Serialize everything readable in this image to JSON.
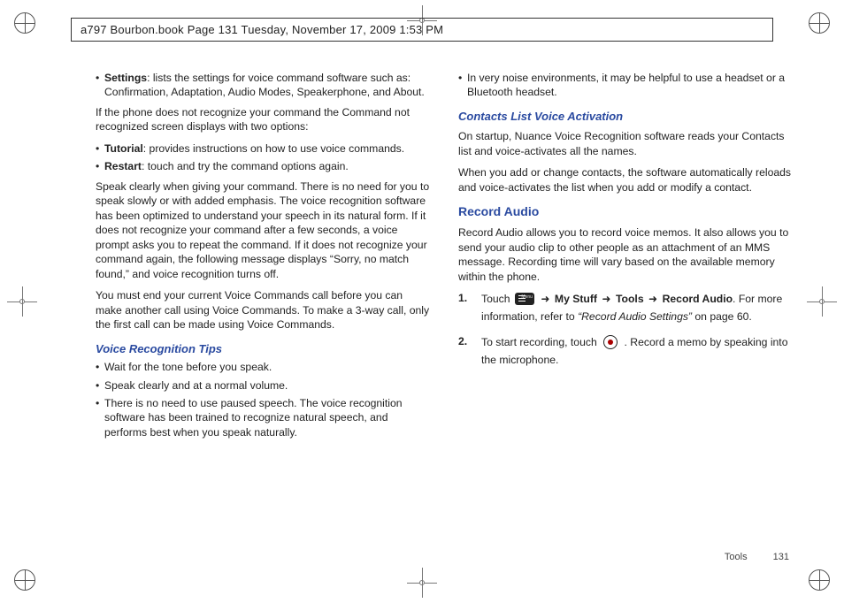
{
  "header": "a797 Bourbon.book  Page 131  Tuesday, November 17, 2009  1:53 PM",
  "left": {
    "settings_lead": "Settings",
    "settings_rest": ": lists the settings for voice command software such as: Confirmation, Adaptation, Audio Modes, Speakerphone, and About.",
    "unrecognized": "If the phone does not recognize your command the Command not recognized screen displays with two options:",
    "tutorial_lead": "Tutorial",
    "tutorial_rest": ": provides instructions on how to use voice commands.",
    "restart_lead": "Restart",
    "restart_rest": ": touch and try the command options again.",
    "speak_clearly": "Speak clearly when giving your command. There is no need for you to speak slowly or with added emphasis. The voice recognition software has been optimized to understand your speech in its natural form. If it does not recognize your command after a few seconds, a voice prompt asks you to repeat the command. If it does not recognize your command again, the following message displays “Sorry, no match found,” and voice recognition turns off.",
    "end_call": "You must end your current Voice Commands call before you can make another call using Voice Commands. To make a 3-way call, only the first call can be made using Voice Commands.",
    "tips_head": "Voice Recognition Tips",
    "tip1": "Wait for the tone before you speak.",
    "tip2": "Speak clearly and at a normal volume.",
    "tip3": "There is no need to use paused speech. The voice recognition software has been trained to recognize natural speech, and performs best when you speak naturally."
  },
  "right": {
    "headset": "In very noise environments, it may be helpful to use a headset or a Bluetooth headset.",
    "contacts_head": "Contacts List Voice Activation",
    "contacts_p1": "On startup, Nuance Voice Recognition software reads your Contacts list and voice-activates all the names.",
    "contacts_p2": "When you add or change contacts, the software automatically reloads and voice-activates the list when you add or modify a contact.",
    "record_head": "Record Audio",
    "record_p1": "Record Audio allows you to record voice memos. It also allows you to send your audio clip to other people as an attachment of an MMS message. Recording time will vary based on the available memory within the phone.",
    "step1_num": "1.",
    "step1_touch": "Touch ",
    "step1_arrow": " ➜ ",
    "step1_mystuff": "My Stuff",
    "step1_tools": "Tools",
    "step1_record": "Record Audio",
    "step1_for": ". For more information, refer to ",
    "step1_ref": "“Record Audio Settings”",
    "step1_on": "  on page 60.",
    "step2_num": "2.",
    "step2_a": "To start recording, touch ",
    "step2_b": ". Record a memo by speaking into the microphone."
  },
  "footer": {
    "section": "Tools",
    "page": "131"
  }
}
